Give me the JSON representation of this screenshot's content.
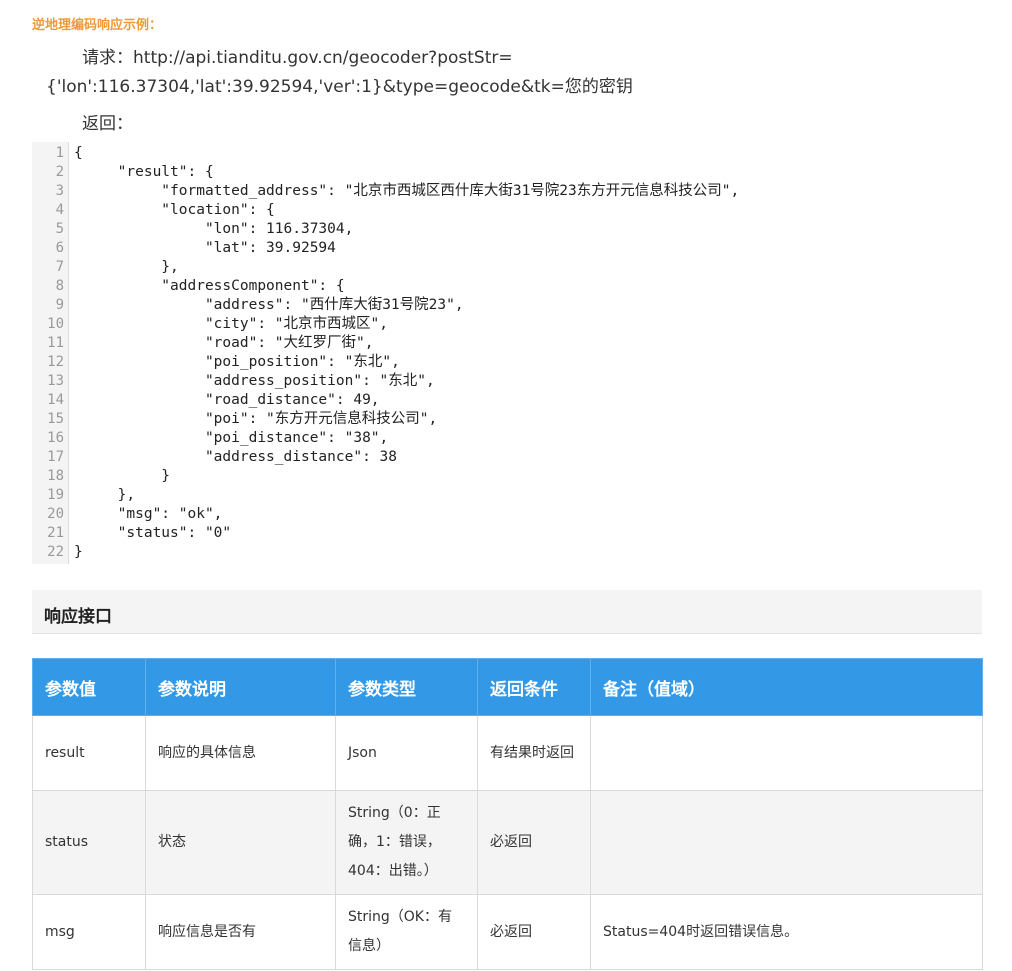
{
  "section_title": "逆地理编码响应示例：",
  "request_line": "请求：http://api.tianditu.gov.cn/geocoder?postStr={'lon':116.37304,'lat':39.92594,'ver':1}&type=geocode&tk=您的密钥",
  "return_label": "返回：",
  "code": {
    "line_numbers": [
      "1",
      "2",
      "3",
      "4",
      "5",
      "6",
      "7",
      "8",
      "9",
      "10",
      "11",
      "12",
      "13",
      "14",
      "15",
      "16",
      "17",
      "18",
      "19",
      "20",
      "21",
      "22"
    ],
    "lines": [
      "{",
      "     \"result\": {",
      "          \"formatted_address\": \"北京市西城区西什库大街31号院23东方开元信息科技公司\",",
      "          \"location\": {",
      "               \"lon\": 116.37304,",
      "               \"lat\": 39.92594",
      "          },",
      "          \"addressComponent\": {",
      "               \"address\": \"西什库大街31号院23\",",
      "               \"city\": \"北京市西城区\",",
      "               \"road\": \"大红罗厂街\",",
      "               \"poi_position\": \"东北\",",
      "               \"address_position\": \"东北\",",
      "               \"road_distance\": 49,",
      "               \"poi\": \"东方开元信息科技公司\",",
      "               \"poi_distance\": \"38\",",
      "               \"address_distance\": 38",
      "          }",
      "     },",
      "     \"msg\": \"ok\",",
      "     \"status\": \"0\"",
      "}"
    ]
  },
  "response_section_title": "响应接口",
  "table": {
    "headers": [
      "参数值",
      "参数说明",
      "参数类型",
      "返回条件",
      "备注（值域）"
    ],
    "rows": [
      [
        "result",
        "响应的具体信息",
        "Json",
        "有结果时返回",
        ""
      ],
      [
        "status",
        "状态",
        "String（0：正确，1：错误，404：出错。）",
        "必返回",
        ""
      ],
      [
        "msg",
        "响应信息是否有",
        "String（OK：有信息）",
        "必返回",
        "Status=404时返回错误信息。"
      ]
    ]
  }
}
